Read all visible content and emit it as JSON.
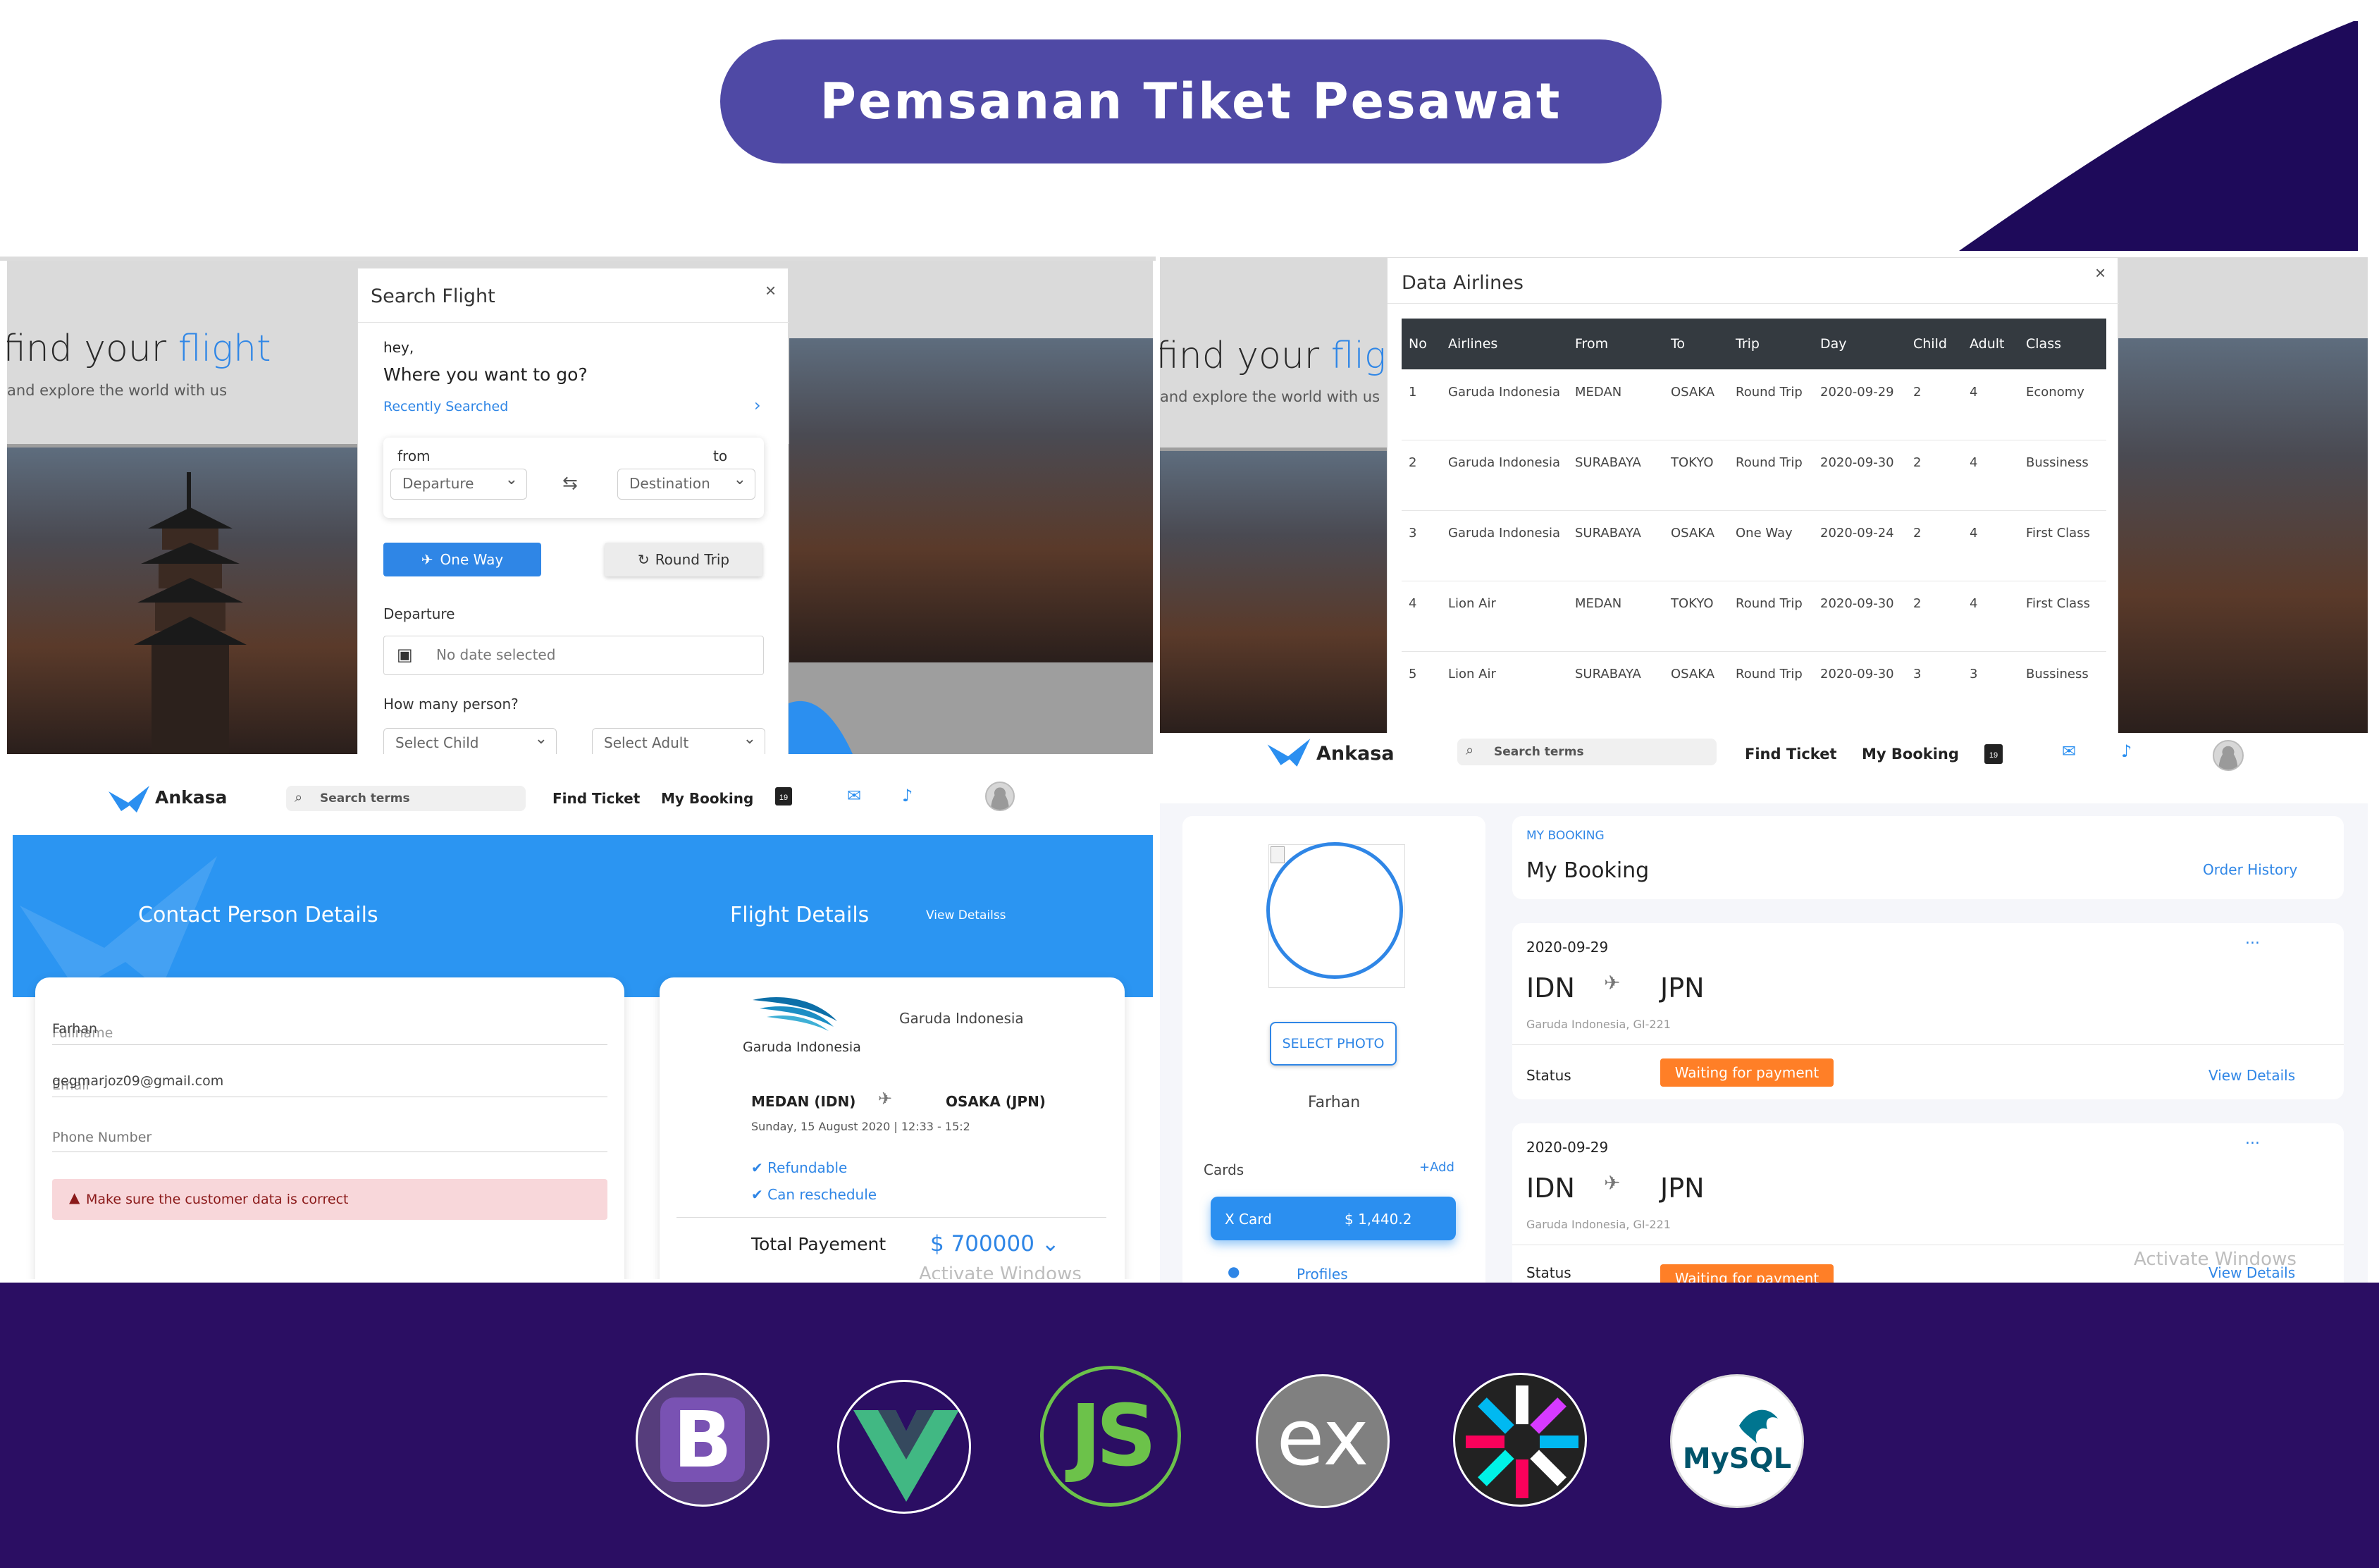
{
  "header": {
    "title": "Pemsanan Tiket Pesawat",
    "accent": "#4f49a5",
    "band_color": "#2b0e63"
  },
  "hero": {
    "headline_a": "find your ",
    "headline_b": "flight",
    "sub": "and explore the world with us"
  },
  "search_flight": {
    "title": "Search Flight",
    "close": "×",
    "greeting": "hey,",
    "question": "Where you want to go?",
    "recent": "Recently Searched",
    "from_label": "from",
    "to_label": "to",
    "from_select": "Departure",
    "to_select": "Destination",
    "one_way": "One Way",
    "round_trip": "Round Trip",
    "departure_label": "Departure",
    "date_placeholder": "No date selected",
    "persons_label": "How many person?",
    "child_select": "Select Child",
    "adult_select": "Select Adult"
  },
  "data_airlines": {
    "title": "Data Airlines",
    "close": "×",
    "columns": [
      "No",
      "Airlines",
      "From",
      "To",
      "Trip",
      "Day",
      "Child",
      "Adult",
      "Class"
    ],
    "rows": [
      [
        "1",
        "Garuda Indonesia",
        "MEDAN",
        "OSAKA",
        "Round Trip",
        "2020-09-29",
        "2",
        "4",
        "Economy"
      ],
      [
        "2",
        "Garuda Indonesia",
        "SURABAYA",
        "TOKYO",
        "Round Trip",
        "2020-09-30",
        "2",
        "4",
        "Bussiness"
      ],
      [
        "3",
        "Garuda Indonesia",
        "SURABAYA",
        "OSAKA",
        "One Way",
        "2020-09-24",
        "2",
        "4",
        "First Class"
      ],
      [
        "4",
        "Lion Air",
        "MEDAN",
        "TOKYO",
        "Round Trip",
        "2020-09-30",
        "2",
        "4",
        "First Class"
      ],
      [
        "5",
        "Lion Air",
        "SURABAYA",
        "OSAKA",
        "Round Trip",
        "2020-09-30",
        "3",
        "3",
        "Bussiness"
      ]
    ]
  },
  "nav": {
    "brand": "Ankasa",
    "search_placeholder": "Search terms",
    "find_ticket": "Find Ticket",
    "my_booking": "My Booking",
    "calendar_day": "19"
  },
  "contact": {
    "section_title": "Contact Person Details",
    "flight_section_title": "Flight Details",
    "view_details": "View Detailss",
    "fullname_label": "Fullname",
    "fullname_value": "Farhan",
    "email_label": "Email",
    "email_value": "gegmarjoz09@gmail.com",
    "phone_label": "Phone Number",
    "warning": "Make sure the customer data is correct"
  },
  "flight_details": {
    "airline_logo_text": "Garuda Indonesia",
    "airline_name": "Garuda Indonesia",
    "from": "MEDAN (IDN)",
    "to": "OSAKA (JPN)",
    "datetime": "Sunday, 15 August 2020 | 12:33 - 15:2",
    "refundable": "Refundable",
    "reschedule": "Can reschedule",
    "total_label": "Total Payement",
    "total_value": "$ 700000 ⌄",
    "watermark": "Activate Windows"
  },
  "my_booking": {
    "select_photo": "SELECT PHOTO",
    "user_name": "Farhan",
    "cards_label": "Cards",
    "add_label": "+Add",
    "card_name": "X Card",
    "card_balance": "$ 1,440.2",
    "profiles": "Profiles",
    "eyebrow": "MY BOOKING",
    "heading": "My Booking",
    "order_history": "Order History",
    "bookings": [
      {
        "date": "2020-09-29",
        "from": "IDN",
        "to": "JPN",
        "flight": "Garuda Indonesia, GI-221",
        "status_label": "Status",
        "status": "Waiting for payment",
        "view": "View Details",
        "menu": "..."
      },
      {
        "date": "2020-09-29",
        "from": "IDN",
        "to": "JPN",
        "flight": "Garuda Indonesia, GI-221",
        "status_label": "Status",
        "status": "Waiting for payment",
        "view": "View Details",
        "menu": "..."
      }
    ],
    "watermark": "Activate Windows"
  },
  "tech_logos": {
    "bootstrap": "B",
    "node": "JS",
    "express": "ex",
    "mysql": "MySQL"
  }
}
